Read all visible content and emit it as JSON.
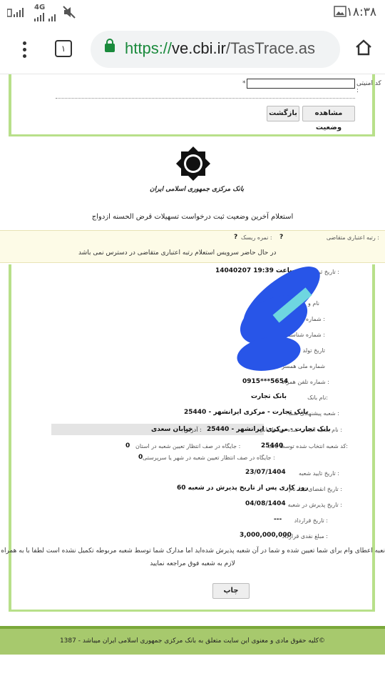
{
  "status_bar": {
    "signal_text": "4G",
    "time": "۱۸:۳۸",
    "icons": [
      "sim-signal-icon",
      "signal-icon",
      "mute-icon",
      "image-icon"
    ]
  },
  "browser": {
    "menu_icon": "overflow-menu-icon",
    "tab_count": "۱",
    "url_scheme": "https://",
    "url_host": "ve.cbi.ir",
    "url_path": "/TasTrace.as",
    "home_icon": "home-icon"
  },
  "form": {
    "security_code_label": "کد امنیتی :",
    "required_mark": "*",
    "security_code_value": "",
    "view_status_button": "مشاهده وضعیت",
    "back_button": "بازگشت"
  },
  "bank": {
    "logo_caption": "بانک مرکزی جمهوری اسلامی ایران",
    "page_title": "استعلام آخرین وضعیت ثبت درخواست تسهیلات قرض الحسنه ازدواج"
  },
  "credit": {
    "rank_label": "رتبه اعتباری متقاضی :",
    "rank_value": "?",
    "risk_label": "نمره ریسک :",
    "risk_value": "?",
    "unavailable_message": "در حال حاضر سرویس استعلام رتبه اعتباری متقاضی در دسترس نمی باشد"
  },
  "details": {
    "request_date_label": "تاریخ ثبت درخواست :",
    "request_date_value": "14040207 ساعت 19:39",
    "name_label": "نام و",
    "national_id_label": "شماره ملی :",
    "id_number_label": "شماره شناسنامه :",
    "birth_date_label": "تاریخ تولد",
    "spouse_id_label": "شماره ملی همسر",
    "mobile_label": "شماره تلفن همراه :",
    "mobile_value": "0915***5654",
    "bank_name_label": "نام بانک:",
    "bank_name_value": "بانک تجارت",
    "suggested_branch_label": "شعبه پیشنهادی شما :",
    "suggested_branch_value": "بانک تجارت - مرکزی ایرانشهر - 25440",
    "selected_branch_label": "نام شعبه انتخاب شده توسط بانک :",
    "selected_branch_value": "بانک تجارت - مرکزی ایرانشهر - 25440",
    "address_label": "آدرس :",
    "address_value": "خیابان سعدی",
    "selected_branch_code_label": "کد شعبه انتخاب شده توسط بانک:",
    "selected_branch_code_value": "25440",
    "province_queue_label": "جایگاه در صف انتظار تعیین شعبه در استان :",
    "province_queue_value": "0",
    "city_queue_label": "جایگاه در صف انتظار تعیین شعبه در شهر یا سرپرستی :",
    "city_queue_value": "0",
    "confirm_date_label": "تاریخ تایید شعبه :",
    "confirm_date_value": "23/07/1404",
    "expiry_label": "تاریخ انقضای ثبت نام :",
    "expiry_value": "60 روز کاری پس از تاریخ پذیرش در شعبه",
    "acceptance_date_label": "تاریخ پذیرش در شعبه :",
    "acceptance_date_value": "04/08/1404",
    "contract_date_label": "تاریخ قرارداد :",
    "contract_date_value": "---",
    "amount_label": "مبلغ نقدی قرارداد :",
    "amount_value": "3,000,000,000"
  },
  "notice": {
    "line1": "نعبه اعطای وام برای شما تعیین شده و شما در آن شعبه پذیرش شده‌اید اما مدارک شما توسط شعبه مربوطه تکمیل نشده است لطفا با به همراه داشتن مدارک",
    "line2": "لازم به شعبه فوق مراجعه نمایید"
  },
  "print_button": "چاپ",
  "footer": {
    "copyright": "کلیه حقوق مادی و معنوی این سایت متعلق به بانک مرکزی جمهوری اسلامی ایران میباشد - 1387©"
  },
  "colors": {
    "accent_green": "#1a8a3c",
    "frame_green": "#b8e08a",
    "footer_green": "#a7c96d",
    "redaction_blue": "#2855e8"
  }
}
